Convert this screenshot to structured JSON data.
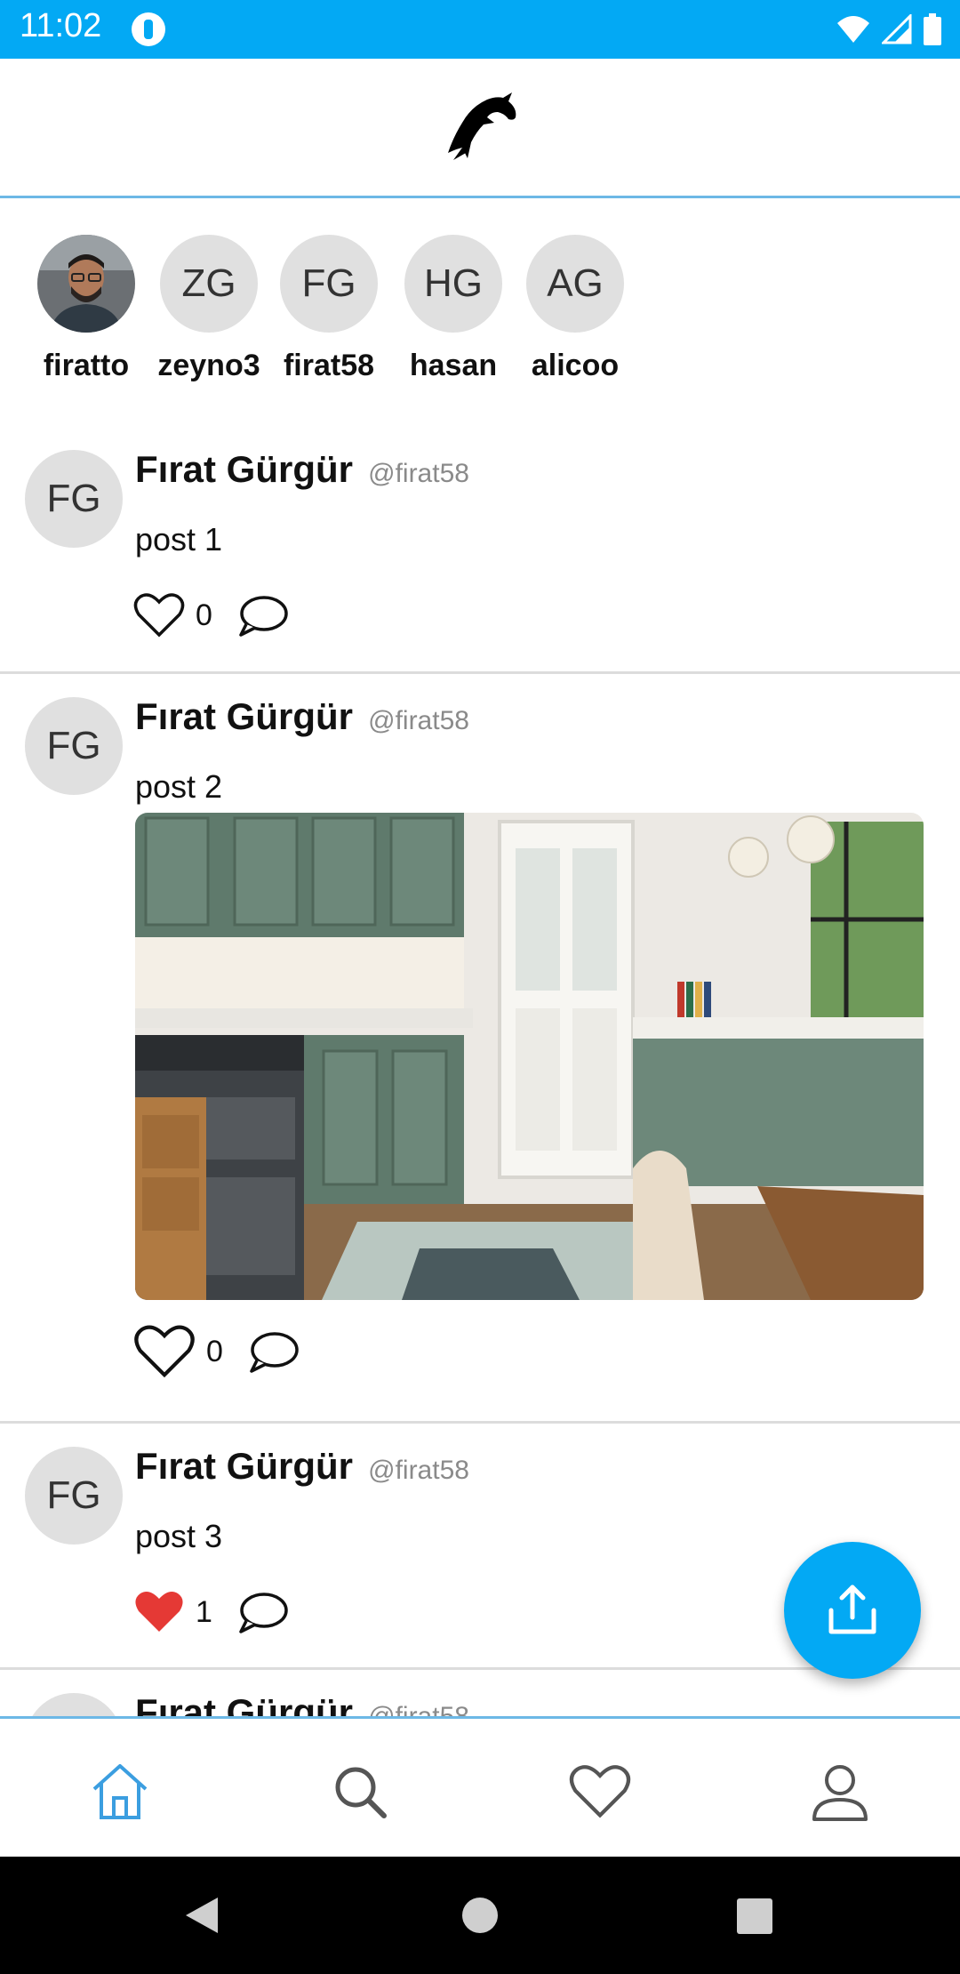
{
  "status_bar": {
    "time": "11:02",
    "color": "#03a9f4"
  },
  "stories": [
    {
      "initials": "",
      "name": "firatto",
      "has_photo": true
    },
    {
      "initials": "ZG",
      "name": "zeyno3"
    },
    {
      "initials": "FG",
      "name": "firat58"
    },
    {
      "initials": "HG",
      "name": "hasan"
    },
    {
      "initials": "AG",
      "name": "alicoo"
    }
  ],
  "posts": [
    {
      "initials": "FG",
      "name": "Fırat Gürgür",
      "handle": "@firat58",
      "text": "post 1",
      "likes": "0",
      "liked": false,
      "has_image": false
    },
    {
      "initials": "FG",
      "name": "Fırat Gürgür",
      "handle": "@firat58",
      "text": "post 2",
      "likes": "0",
      "liked": false,
      "has_image": true,
      "image_desc": "kitchen-photo"
    },
    {
      "initials": "FG",
      "name": "Fırat Gürgür",
      "handle": "@firat58",
      "text": "post 3",
      "likes": "1",
      "liked": true,
      "has_image": false
    },
    {
      "initials": "FG",
      "name": "Fırat Gürgür",
      "handle": "@firat58"
    }
  ],
  "bottom_nav": [
    {
      "icon": "home-icon",
      "active": true
    },
    {
      "icon": "search-icon",
      "active": false
    },
    {
      "icon": "heart-icon",
      "active": false
    },
    {
      "icon": "profile-icon",
      "active": false
    }
  ],
  "colors": {
    "accent": "#03a9f4",
    "like": "#e53935",
    "divider": "#dcdcdc"
  }
}
